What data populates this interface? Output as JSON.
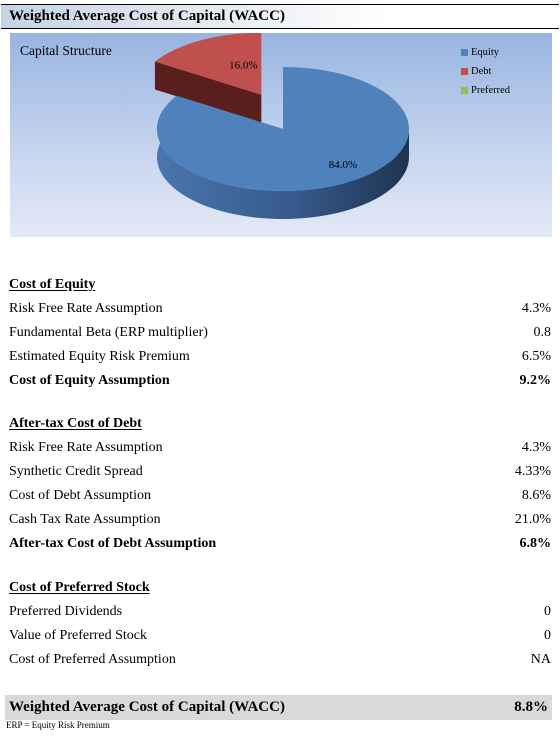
{
  "title": "Weighted Average Cost of Capital (WACC)",
  "chart_data": {
    "type": "pie",
    "title": "Capital Structure",
    "categories": [
      "Equity",
      "Debt",
      "Preferred"
    ],
    "values": [
      84.0,
      16.0,
      0.0
    ],
    "labels": [
      "84.0%",
      "16.0%",
      ""
    ],
    "colors": [
      "#4F81BD",
      "#C0504D",
      "#9BBB59"
    ],
    "legend_position": "top-right",
    "exploded": [
      "Debt"
    ],
    "style": "3d"
  },
  "sections": [
    {
      "header": "Cost of Equity",
      "rows": [
        {
          "label": "Risk Free Rate Assumption",
          "value": "4.3%"
        },
        {
          "label": "Fundamental Beta (ERP multiplier)",
          "value": "0.8"
        },
        {
          "label": "Estimated Equity Risk Premium",
          "value": "6.5%"
        }
      ],
      "total": {
        "label": "Cost of Equity Assumption",
        "value": "9.2%"
      }
    },
    {
      "header": "After-tax Cost of Debt",
      "rows": [
        {
          "label": "Risk Free Rate Assumption",
          "value": "4.3%"
        },
        {
          "label": "Synthetic Credit Spread",
          "value": "4.33%"
        },
        {
          "label": "Cost of Debt Assumption",
          "value": "8.6%"
        },
        {
          "label": "Cash Tax Rate Assumption",
          "value": "21.0%"
        }
      ],
      "total": {
        "label": "After-tax Cost of Debt Assumption",
        "value": "6.8%"
      }
    },
    {
      "header": "Cost of Preferred Stock",
      "rows": [
        {
          "label": "Preferred Dividends",
          "value": "0"
        },
        {
          "label": "Value of Preferred Stock",
          "value": "0"
        },
        {
          "label": "Cost of Preferred Assumption",
          "value": "NA"
        }
      ]
    }
  ],
  "wacc": {
    "label": "Weighted Average Cost of Capital (WACC)",
    "value": "8.8%"
  },
  "footnote": "ERP = Equity Risk Premium"
}
